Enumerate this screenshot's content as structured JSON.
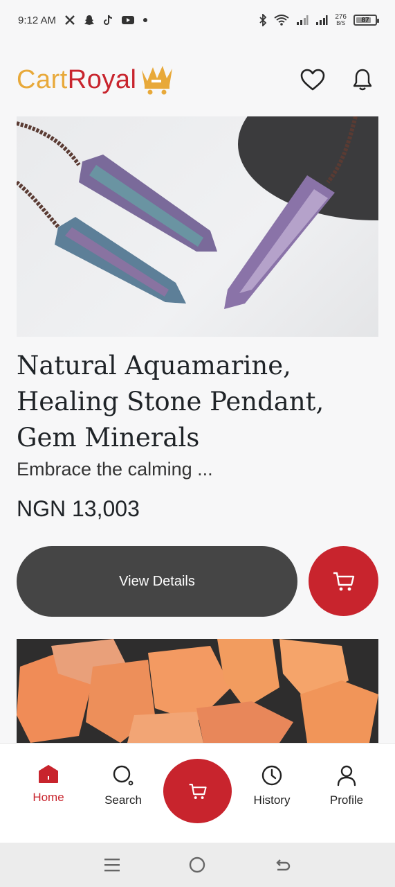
{
  "status_bar": {
    "time": "9:12 AM",
    "net_speed_value": "276",
    "net_speed_unit": "B/S",
    "battery": "87"
  },
  "header": {
    "logo_part1": "Cart",
    "logo_part2": "Royal"
  },
  "product": {
    "title": "Natural Aquamarine, Healing Stone Pendant, Gem Minerals",
    "description": "Embrace the calming ...",
    "price": "NGN 13,003",
    "view_details_label": "View Details"
  },
  "bottom_nav": {
    "home": "Home",
    "search": "Search",
    "history": "History",
    "profile": "Profile"
  },
  "colors": {
    "brand_red": "#c8242d",
    "brand_gold": "#e8a93a",
    "button_dark": "#454545"
  }
}
